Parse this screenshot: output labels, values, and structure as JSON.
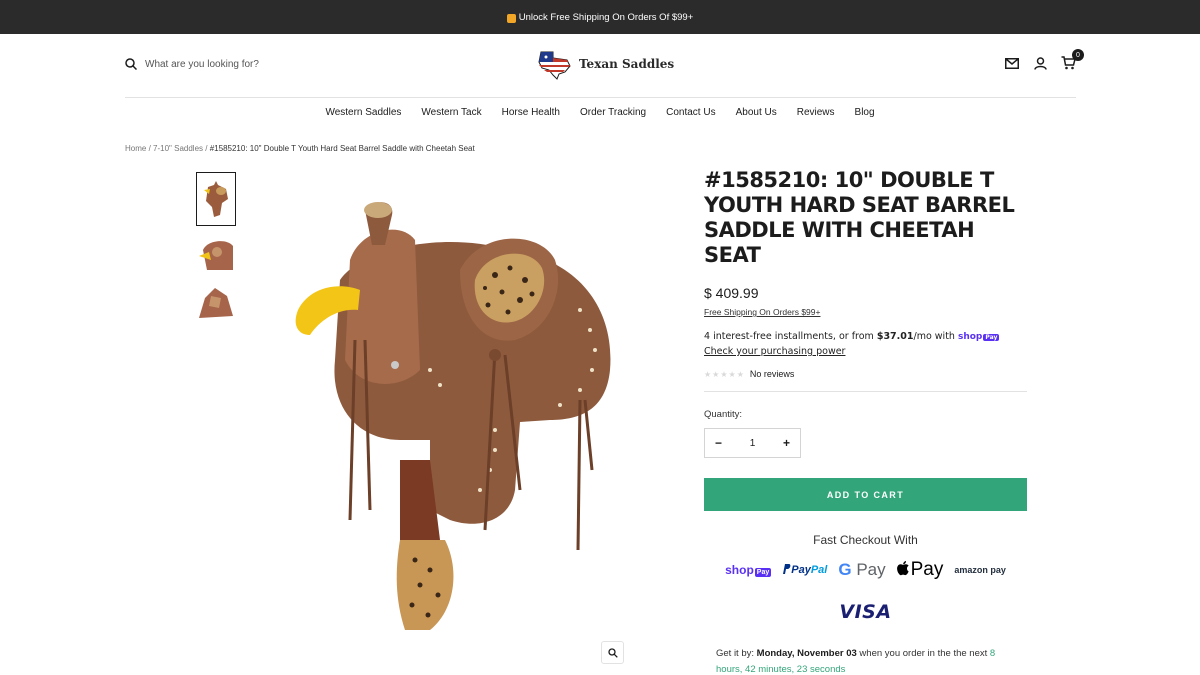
{
  "announcement": {
    "text": "Unlock Free Shipping On Orders Of $99+"
  },
  "header": {
    "search_placeholder": "What are you looking for?",
    "logo_text": "Texan Saddles",
    "cart_count": "0"
  },
  "nav": {
    "items": [
      "Western Saddles",
      "Western Tack",
      "Horse Health",
      "Order Tracking",
      "Contact Us",
      "About Us",
      "Reviews",
      "Blog"
    ]
  },
  "breadcrumb": {
    "home": "Home",
    "sep": "/",
    "category": "7-10\" Saddles",
    "current": "#1585210: 10\" Double T Youth Hard Seat Barrel Saddle with Cheetah Seat"
  },
  "product": {
    "title": "#1585210: 10\" Double T Youth Hard Seat Barrel Saddle with Cheetah Seat",
    "price": "$ 409.99",
    "free_shipping": "Free Shipping On Orders $99+",
    "installments_prefix": "4 interest-free installments, or from ",
    "installments_amount": "$37.01",
    "installments_suffix": "/mo with",
    "shoppay_label": "shop",
    "shoppay_badge": "Pay",
    "check_power": "Check your purchasing power",
    "stars": "★★★★★",
    "reviews": "No reviews",
    "quantity_label": "Quantity:",
    "quantity_value": "1",
    "minus": "−",
    "plus": "+",
    "add_to_cart": "ADD TO CART",
    "fast_checkout": "Fast Checkout With",
    "payments": {
      "shop": "shop",
      "shop_badge": "Pay",
      "paypal_1": "Pay",
      "paypal_2": "Pal",
      "gpay_g": "G",
      "gpay_text": "Pay",
      "apple": "Pay",
      "amazon": "amazon pay"
    },
    "visa": "VISA"
  },
  "delivery": {
    "prefix": "Get it by: ",
    "date": "Monday, November 03",
    "middle": " when you order in the the next ",
    "timer": "8 hours, 42 minutes, 23 seconds"
  },
  "colors": {
    "accent": "#33a57a",
    "topbar": "#2b2b2b",
    "shoppay": "#5a31f4"
  }
}
